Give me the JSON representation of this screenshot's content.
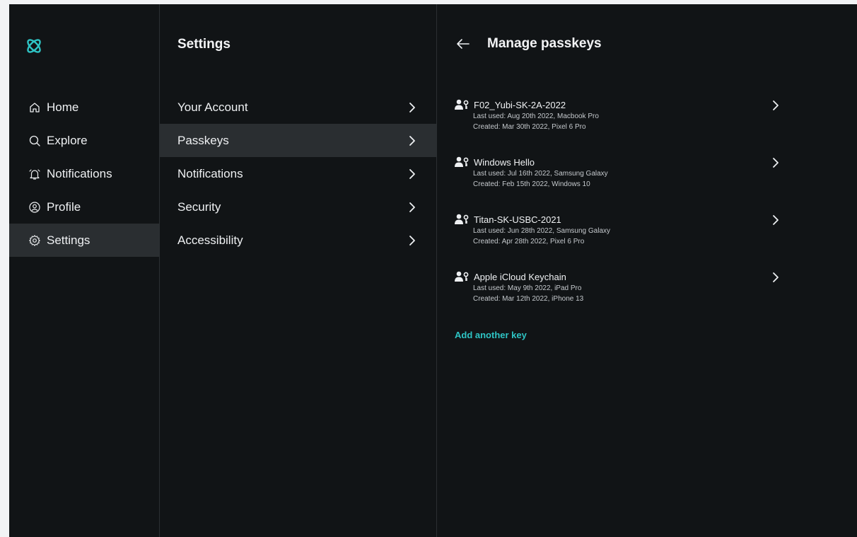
{
  "colors": {
    "background": "#111416",
    "active_row": "#2a2e31",
    "accent": "#2ec4c4",
    "text": "#eef0f2"
  },
  "logo": {
    "icon": "atom-logo-icon"
  },
  "nav": {
    "items": [
      {
        "label": "Home",
        "icon": "home-icon",
        "active": false
      },
      {
        "label": "Explore",
        "icon": "search-icon",
        "active": false
      },
      {
        "label": "Notifications",
        "icon": "bell-icon",
        "active": false
      },
      {
        "label": "Profile",
        "icon": "profile-icon",
        "active": false
      },
      {
        "label": "Settings",
        "icon": "gear-icon",
        "active": true
      }
    ]
  },
  "settings": {
    "title": "Settings",
    "items": [
      {
        "label": "Your Account",
        "active": false
      },
      {
        "label": "Passkeys",
        "active": true
      },
      {
        "label": "Notifications",
        "active": false
      },
      {
        "label": "Security",
        "active": false
      },
      {
        "label": "Accessibility",
        "active": false
      }
    ]
  },
  "passkeys": {
    "title": "Manage passkeys",
    "back_icon": "arrow-left-icon",
    "keys": [
      {
        "name": "F02_Yubi-SK-2A-2022",
        "last_used": "Last used: Aug 20th 2022, Macbook Pro",
        "created": "Created: Mar 30th 2022, Pixel 6 Pro"
      },
      {
        "name": "Windows Hello",
        "last_used": "Last used: Jul 16th 2022, Samsung Galaxy",
        "created": "Created: Feb 15th 2022, Windows 10"
      },
      {
        "name": "Titan-SK-USBC-2021",
        "last_used": "Last used: Jun 28th 2022, Samsung Galaxy",
        "created": "Created: Apr 28th 2022, Pixel 6 Pro"
      },
      {
        "name": "Apple iCloud Keychain",
        "last_used": "Last used: May 9th 2022, iPad Pro",
        "created": "Created: Mar 12th 2022, iPhone 13"
      }
    ],
    "add_label": "Add another key"
  }
}
